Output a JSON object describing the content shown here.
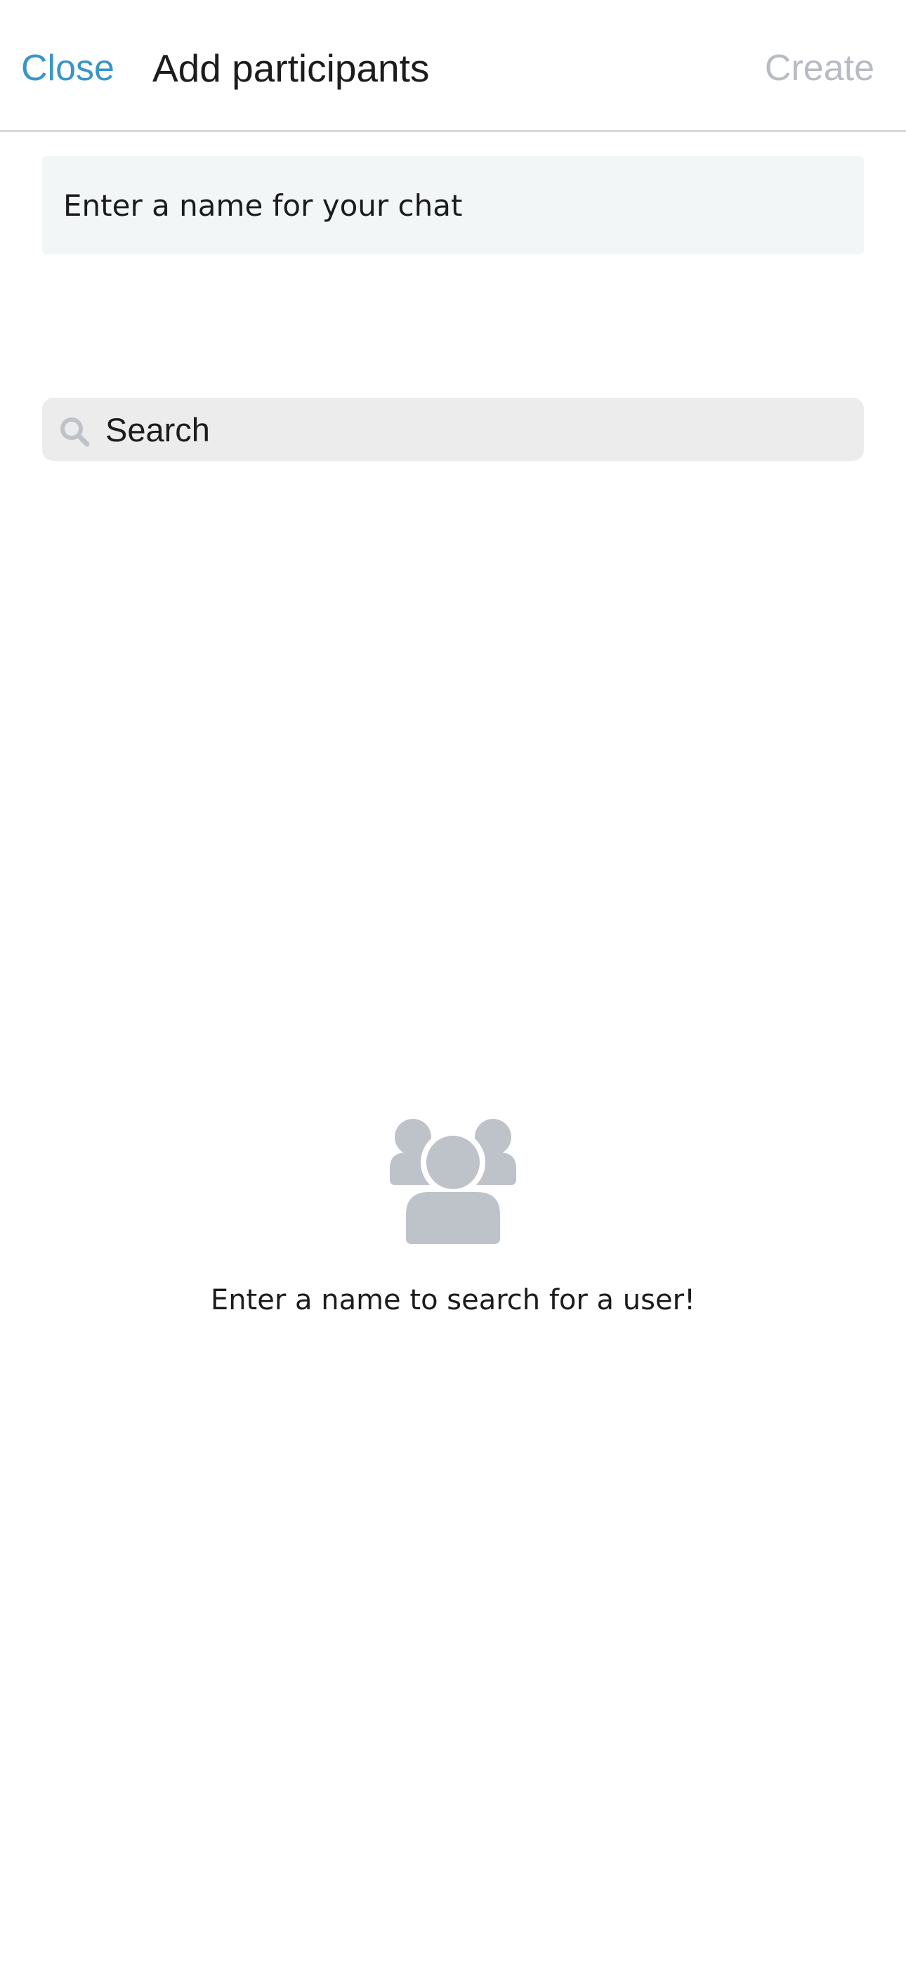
{
  "header": {
    "close_label": "Close",
    "title": "Add participants",
    "create_label": "Create"
  },
  "chat_name": {
    "placeholder": "Enter a name for your chat",
    "value": ""
  },
  "search": {
    "placeholder": "Search",
    "value": "",
    "icon": "search-icon"
  },
  "empty_state": {
    "icon": "group-icon",
    "message": "Enter a name to search for a user!"
  },
  "colors": {
    "accent": "#3a95c9",
    "disabled": "#b8bcc2",
    "icon_gray": "#bec3ca",
    "field_bg": "#f3f6f6",
    "search_bg": "#ececec"
  }
}
